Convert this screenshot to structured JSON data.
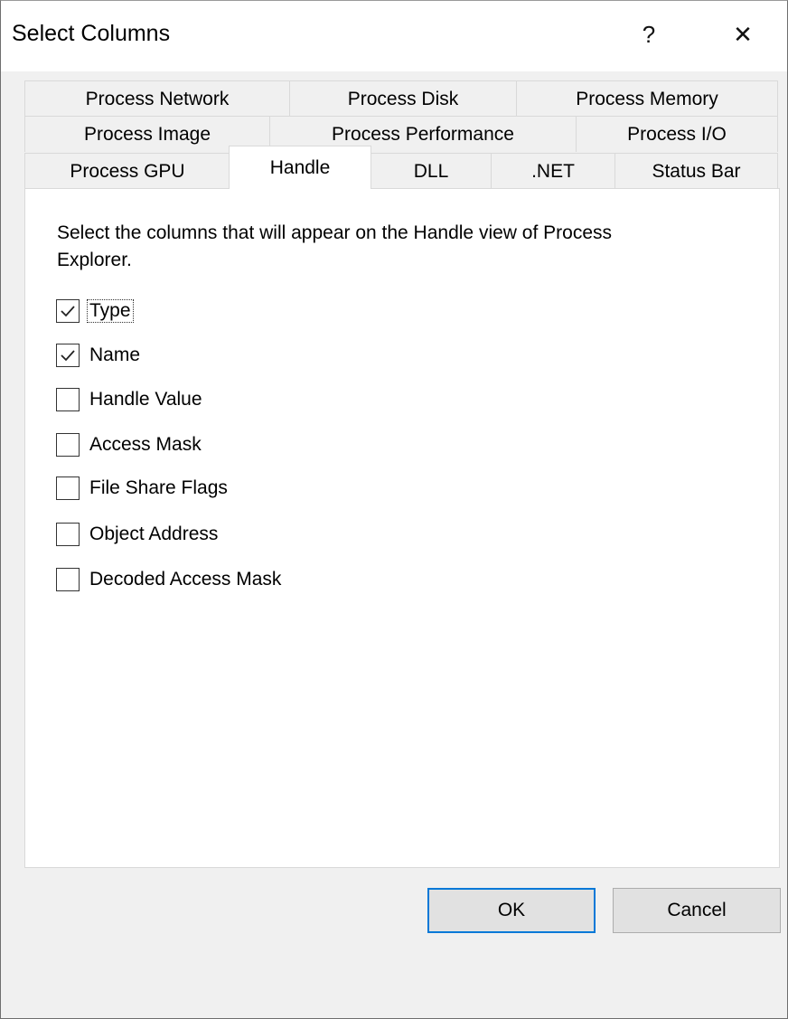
{
  "window": {
    "title": "Select Columns",
    "help_label": "?",
    "close_label": "✕"
  },
  "tabs": {
    "row1": [
      "Process Network",
      "Process Disk",
      "Process Memory"
    ],
    "row2": [
      "Process Image",
      "Process Performance",
      "Process I/O"
    ],
    "row3": [
      "Process GPU",
      "Handle",
      "DLL",
      ".NET",
      "Status Bar"
    ],
    "selected": "Handle"
  },
  "panel": {
    "description": "Select the columns that will appear on the Handle view of Process Explorer.",
    "options": [
      {
        "label": "Type",
        "checked": true
      },
      {
        "label": "Name",
        "checked": true
      },
      {
        "label": "Handle Value",
        "checked": false
      },
      {
        "label": "Access Mask",
        "checked": false
      },
      {
        "label": "File Share Flags",
        "checked": false
      },
      {
        "label": "Object Address",
        "checked": false
      },
      {
        "label": "Decoded Access Mask",
        "checked": false
      }
    ]
  },
  "buttons": {
    "ok_label": "OK",
    "cancel_label": "Cancel"
  },
  "colors": {
    "default_button_border": "#0078d7",
    "panel_background": "#ffffff",
    "dialog_background": "#f0f0f0"
  }
}
